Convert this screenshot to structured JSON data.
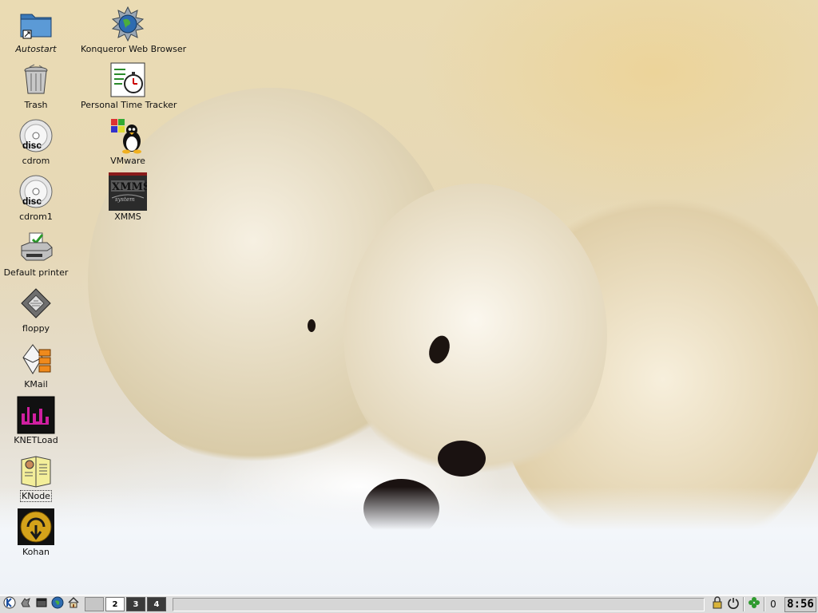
{
  "desktop": {
    "icons_left": [
      {
        "label": "Autostart",
        "icon": "folder-icon"
      },
      {
        "label": "Trash",
        "icon": "trash-icon"
      },
      {
        "label": "cdrom",
        "icon": "cdrom-icon"
      },
      {
        "label": "cdrom1",
        "icon": "cdrom-icon"
      },
      {
        "label": "Default printer",
        "icon": "printer-icon"
      },
      {
        "label": "floppy",
        "icon": "floppy-icon"
      },
      {
        "label": "KMail",
        "icon": "kmail-icon"
      },
      {
        "label": "KNETLoad",
        "icon": "knetload-icon"
      },
      {
        "label": "KNode",
        "icon": "knode-icon"
      },
      {
        "label": "Kohan",
        "icon": "kohan-icon"
      }
    ],
    "icons_right": [
      {
        "label": "Konqueror Web Browser",
        "icon": "konqueror-globe-icon"
      },
      {
        "label": "Personal Time Tracker",
        "icon": "time-tracker-icon"
      },
      {
        "label": "VMware",
        "icon": "vmware-tux-icon"
      },
      {
        "label": "XMMS",
        "icon": "xmms-icon"
      }
    ]
  },
  "panel": {
    "pager": {
      "desktops": [
        "",
        "2",
        "3",
        "4"
      ],
      "active_index": 1
    },
    "tray": {
      "counter": "0"
    },
    "clock": "8:56"
  }
}
